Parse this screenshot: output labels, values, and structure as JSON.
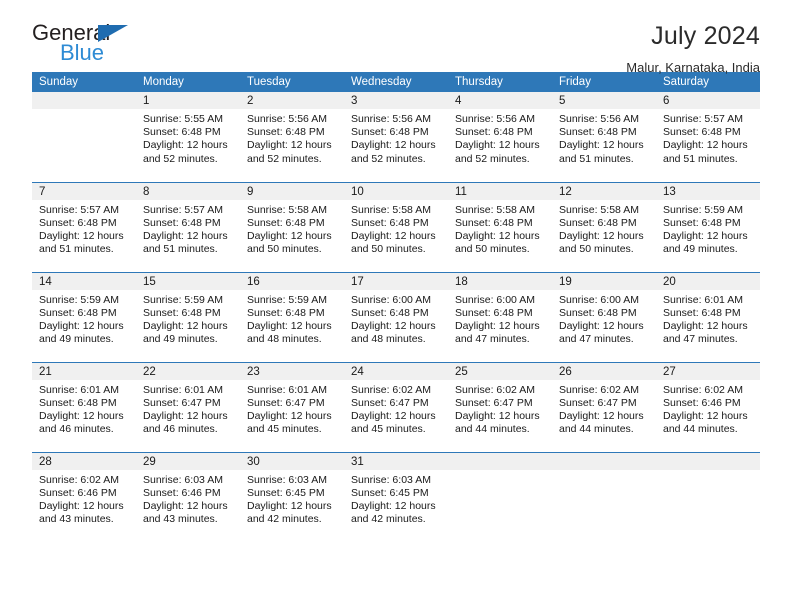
{
  "brand": {
    "name_dark": "General",
    "name_blue": "Blue",
    "accent_blue": "#2e78b8",
    "logo_blue": "#2e8bd4"
  },
  "header": {
    "title": "July 2024",
    "subtitle": "Malur, Karnataka, India"
  },
  "calendar": {
    "weekdays": [
      "Sunday",
      "Monday",
      "Tuesday",
      "Wednesday",
      "Thursday",
      "Friday",
      "Saturday"
    ],
    "weeks": [
      [
        {
          "day": "",
          "lines": []
        },
        {
          "day": "1",
          "lines": [
            "Sunrise: 5:55 AM",
            "Sunset: 6:48 PM",
            "Daylight: 12 hours",
            "and 52 minutes."
          ]
        },
        {
          "day": "2",
          "lines": [
            "Sunrise: 5:56 AM",
            "Sunset: 6:48 PM",
            "Daylight: 12 hours",
            "and 52 minutes."
          ]
        },
        {
          "day": "3",
          "lines": [
            "Sunrise: 5:56 AM",
            "Sunset: 6:48 PM",
            "Daylight: 12 hours",
            "and 52 minutes."
          ]
        },
        {
          "day": "4",
          "lines": [
            "Sunrise: 5:56 AM",
            "Sunset: 6:48 PM",
            "Daylight: 12 hours",
            "and 52 minutes."
          ]
        },
        {
          "day": "5",
          "lines": [
            "Sunrise: 5:56 AM",
            "Sunset: 6:48 PM",
            "Daylight: 12 hours",
            "and 51 minutes."
          ]
        },
        {
          "day": "6",
          "lines": [
            "Sunrise: 5:57 AM",
            "Sunset: 6:48 PM",
            "Daylight: 12 hours",
            "and 51 minutes."
          ]
        }
      ],
      [
        {
          "day": "7",
          "lines": [
            "Sunrise: 5:57 AM",
            "Sunset: 6:48 PM",
            "Daylight: 12 hours",
            "and 51 minutes."
          ]
        },
        {
          "day": "8",
          "lines": [
            "Sunrise: 5:57 AM",
            "Sunset: 6:48 PM",
            "Daylight: 12 hours",
            "and 51 minutes."
          ]
        },
        {
          "day": "9",
          "lines": [
            "Sunrise: 5:58 AM",
            "Sunset: 6:48 PM",
            "Daylight: 12 hours",
            "and 50 minutes."
          ]
        },
        {
          "day": "10",
          "lines": [
            "Sunrise: 5:58 AM",
            "Sunset: 6:48 PM",
            "Daylight: 12 hours",
            "and 50 minutes."
          ]
        },
        {
          "day": "11",
          "lines": [
            "Sunrise: 5:58 AM",
            "Sunset: 6:48 PM",
            "Daylight: 12 hours",
            "and 50 minutes."
          ]
        },
        {
          "day": "12",
          "lines": [
            "Sunrise: 5:58 AM",
            "Sunset: 6:48 PM",
            "Daylight: 12 hours",
            "and 50 minutes."
          ]
        },
        {
          "day": "13",
          "lines": [
            "Sunrise: 5:59 AM",
            "Sunset: 6:48 PM",
            "Daylight: 12 hours",
            "and 49 minutes."
          ]
        }
      ],
      [
        {
          "day": "14",
          "lines": [
            "Sunrise: 5:59 AM",
            "Sunset: 6:48 PM",
            "Daylight: 12 hours",
            "and 49 minutes."
          ]
        },
        {
          "day": "15",
          "lines": [
            "Sunrise: 5:59 AM",
            "Sunset: 6:48 PM",
            "Daylight: 12 hours",
            "and 49 minutes."
          ]
        },
        {
          "day": "16",
          "lines": [
            "Sunrise: 5:59 AM",
            "Sunset: 6:48 PM",
            "Daylight: 12 hours",
            "and 48 minutes."
          ]
        },
        {
          "day": "17",
          "lines": [
            "Sunrise: 6:00 AM",
            "Sunset: 6:48 PM",
            "Daylight: 12 hours",
            "and 48 minutes."
          ]
        },
        {
          "day": "18",
          "lines": [
            "Sunrise: 6:00 AM",
            "Sunset: 6:48 PM",
            "Daylight: 12 hours",
            "and 47 minutes."
          ]
        },
        {
          "day": "19",
          "lines": [
            "Sunrise: 6:00 AM",
            "Sunset: 6:48 PM",
            "Daylight: 12 hours",
            "and 47 minutes."
          ]
        },
        {
          "day": "20",
          "lines": [
            "Sunrise: 6:01 AM",
            "Sunset: 6:48 PM",
            "Daylight: 12 hours",
            "and 47 minutes."
          ]
        }
      ],
      [
        {
          "day": "21",
          "lines": [
            "Sunrise: 6:01 AM",
            "Sunset: 6:48 PM",
            "Daylight: 12 hours",
            "and 46 minutes."
          ]
        },
        {
          "day": "22",
          "lines": [
            "Sunrise: 6:01 AM",
            "Sunset: 6:47 PM",
            "Daylight: 12 hours",
            "and 46 minutes."
          ]
        },
        {
          "day": "23",
          "lines": [
            "Sunrise: 6:01 AM",
            "Sunset: 6:47 PM",
            "Daylight: 12 hours",
            "and 45 minutes."
          ]
        },
        {
          "day": "24",
          "lines": [
            "Sunrise: 6:02 AM",
            "Sunset: 6:47 PM",
            "Daylight: 12 hours",
            "and 45 minutes."
          ]
        },
        {
          "day": "25",
          "lines": [
            "Sunrise: 6:02 AM",
            "Sunset: 6:47 PM",
            "Daylight: 12 hours",
            "and 44 minutes."
          ]
        },
        {
          "day": "26",
          "lines": [
            "Sunrise: 6:02 AM",
            "Sunset: 6:47 PM",
            "Daylight: 12 hours",
            "and 44 minutes."
          ]
        },
        {
          "day": "27",
          "lines": [
            "Sunrise: 6:02 AM",
            "Sunset: 6:46 PM",
            "Daylight: 12 hours",
            "and 44 minutes."
          ]
        }
      ],
      [
        {
          "day": "28",
          "lines": [
            "Sunrise: 6:02 AM",
            "Sunset: 6:46 PM",
            "Daylight: 12 hours",
            "and 43 minutes."
          ]
        },
        {
          "day": "29",
          "lines": [
            "Sunrise: 6:03 AM",
            "Sunset: 6:46 PM",
            "Daylight: 12 hours",
            "and 43 minutes."
          ]
        },
        {
          "day": "30",
          "lines": [
            "Sunrise: 6:03 AM",
            "Sunset: 6:45 PM",
            "Daylight: 12 hours",
            "and 42 minutes."
          ]
        },
        {
          "day": "31",
          "lines": [
            "Sunrise: 6:03 AM",
            "Sunset: 6:45 PM",
            "Daylight: 12 hours",
            "and 42 minutes."
          ]
        },
        {
          "day": "",
          "lines": []
        },
        {
          "day": "",
          "lines": []
        },
        {
          "day": "",
          "lines": []
        }
      ]
    ]
  }
}
